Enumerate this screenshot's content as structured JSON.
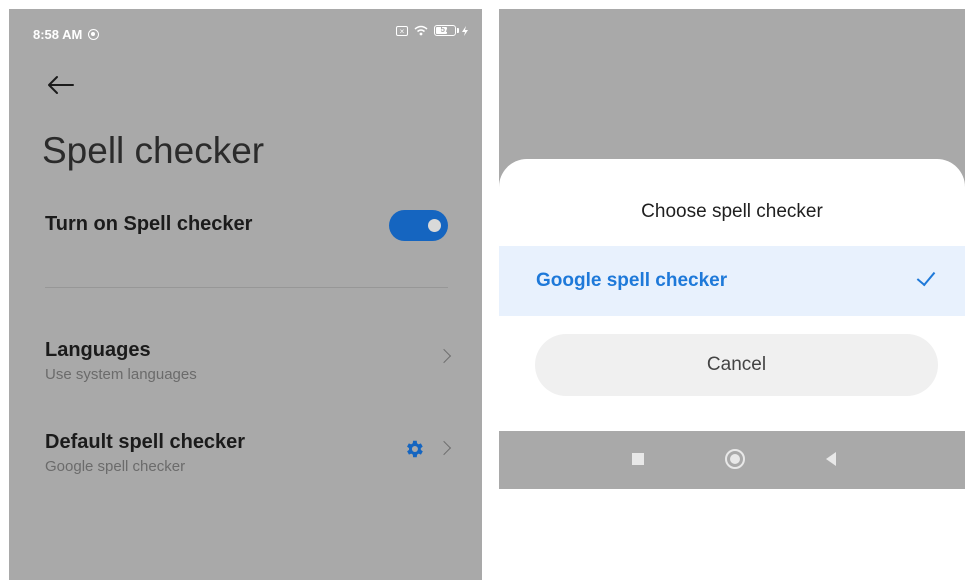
{
  "status_bar": {
    "time": "8:58 AM",
    "battery_level": "57"
  },
  "settings": {
    "title": "Spell checker",
    "toggle": {
      "label": "Turn on Spell checker",
      "on": true
    },
    "languages": {
      "title": "Languages",
      "subtitle": "Use system languages"
    },
    "default_checker": {
      "title": "Default spell checker",
      "subtitle": "Google spell checker"
    }
  },
  "dialog": {
    "title": "Choose spell checker",
    "options": [
      {
        "label": "Google spell checker",
        "selected": true
      }
    ],
    "cancel_label": "Cancel"
  },
  "colors": {
    "accent": "#1e79d9",
    "toggle_on": "#1565c0",
    "overlay": "#a9a9a9"
  },
  "icons": [
    "back-arrow-icon",
    "gear-icon",
    "chevron-right-icon",
    "checkmark-icon",
    "wifi-icon",
    "battery-icon"
  ]
}
